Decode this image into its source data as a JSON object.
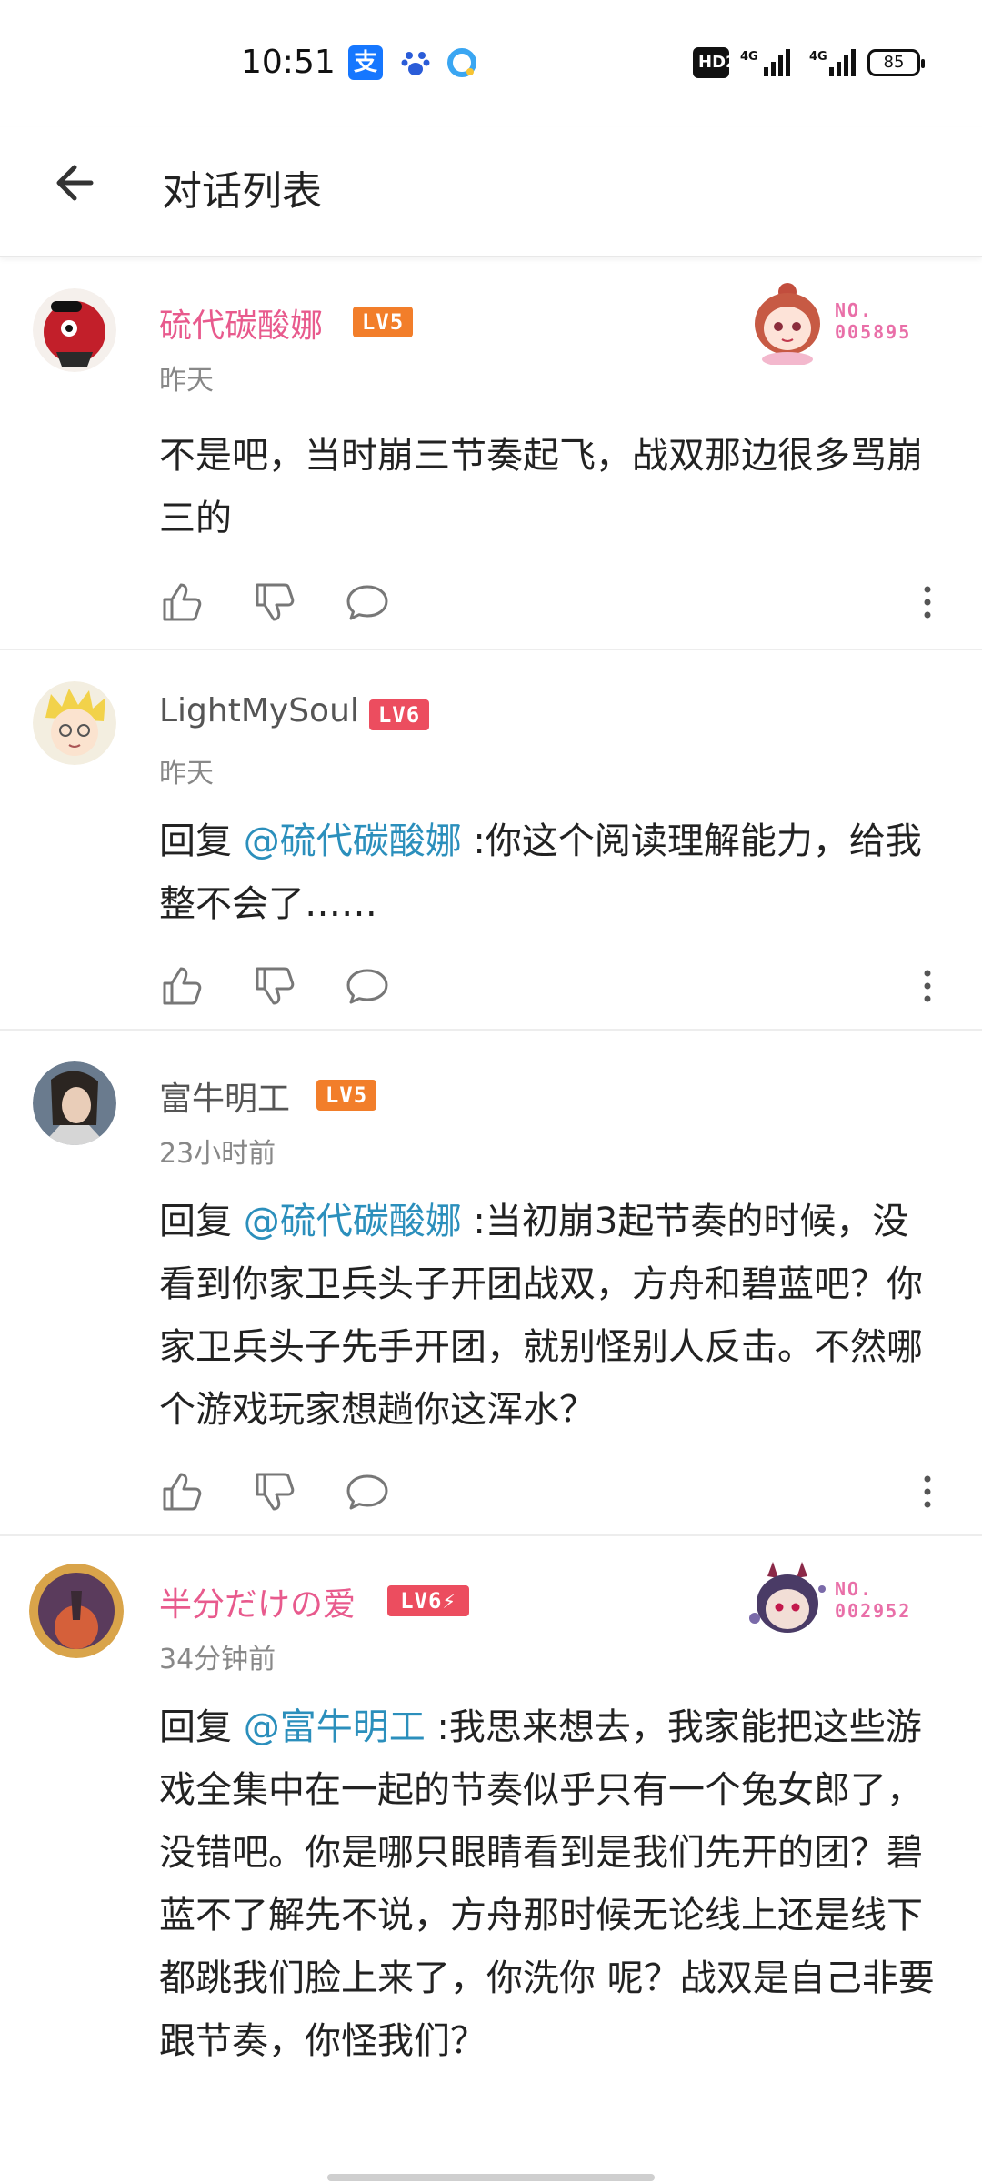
{
  "status_bar": {
    "time": "10:51",
    "hd_label": "HD2",
    "signal1": "⁴ᴳıl",
    "signal2": "⁴ᴳıl",
    "battery": "85"
  },
  "header": {
    "title": "对话列表"
  },
  "comments": [
    {
      "username": "硫代碳酸娜",
      "name_color": "#e85a8d",
      "level": "LV5",
      "time": "昨天",
      "text": "不是吧，当时崩三节奏起飞，战双那边很多骂崩三的",
      "badge_no": "NO.",
      "badge_num": "005895"
    },
    {
      "username": "LightMySoul",
      "level": "LV6",
      "time": "昨天",
      "reply_prefix": "回复 ",
      "mention": "@硫代碳酸娜",
      "text": " :你这个阅读理解能力，给我整不会了……"
    },
    {
      "username": "富牛明工",
      "level": "LV5",
      "time": "23小时前",
      "reply_prefix": "回复 ",
      "mention": "@硫代碳酸娜",
      "text": " :当初崩3起节奏的时候，没看到你家卫兵头子开团战双，方舟和碧蓝吧？你家卫兵头子先手开团，就别怪别人反击。不然哪个游戏玩家想趟你这浑水？"
    },
    {
      "username": "半分だけの爱",
      "name_color": "#e85a8d",
      "level": "LV6⚡",
      "time": "34分钟前",
      "reply_prefix": "回复 ",
      "mention": "@富牛明工",
      "text": " :我思来想去，我家能把这些游戏全集中在一起的节奏似乎只有一个兔女郎了，没错吧。你是哪只眼睛看到是我们先开的团？碧蓝不了解先不说，方舟那时候无论线上还是线下都跳我们脸上来了，你洗你  呢？战双是自己非要跟节奏，你怪我们？",
      "badge_no": "NO.",
      "badge_num": "002952"
    }
  ],
  "colors": {
    "pink_name": "#e85a8d",
    "mention": "#2b8fbc",
    "lv5": "#f27e2a",
    "lv6": "#ec4d5f"
  },
  "icons": [
    "back-arrow-icon",
    "thumb-up-icon",
    "thumb-down-icon",
    "comment-bubble-icon",
    "more-vertical-icon"
  ]
}
